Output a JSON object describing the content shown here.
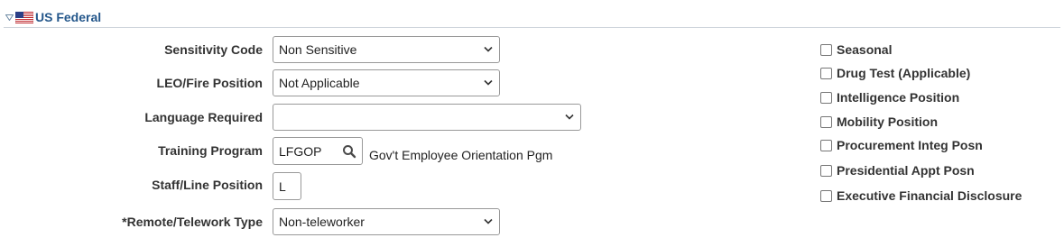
{
  "section": {
    "title": "US Federal"
  },
  "fields": {
    "sensitivity_code": {
      "label": "Sensitivity Code",
      "value": "Non Sensitive"
    },
    "leo_fire_position": {
      "label": "LEO/Fire Position",
      "value": "Not Applicable"
    },
    "language_required": {
      "label": "Language Required",
      "value": ""
    },
    "training_program": {
      "label": "Training Program",
      "value": "LFGOP",
      "description": "Gov't Employee Orientation Pgm"
    },
    "staff_line_position": {
      "label": "Staff/Line Position",
      "value": "L"
    },
    "remote_telework_type": {
      "label": "*Remote/Telework Type",
      "value": "Non-teleworker"
    }
  },
  "checkboxes": [
    {
      "label": "Seasonal",
      "checked": false
    },
    {
      "label": "Drug Test (Applicable)",
      "checked": false
    },
    {
      "label": "Intelligence Position",
      "checked": false
    },
    {
      "label": "Mobility Position",
      "checked": false
    },
    {
      "label": "Procurement Integ Posn",
      "checked": false
    },
    {
      "label": "Presidential Appt Posn",
      "checked": false
    },
    {
      "label": "Executive Financial Disclosure",
      "checked": false
    }
  ],
  "icons": {
    "collapse": "triangle-down-icon",
    "flag": "us-flag-icon",
    "lookup": "search-icon",
    "dropdown": "chevron-down-icon"
  },
  "colors": {
    "section_title": "#24578b",
    "label": "#333333",
    "border": "#999999"
  }
}
